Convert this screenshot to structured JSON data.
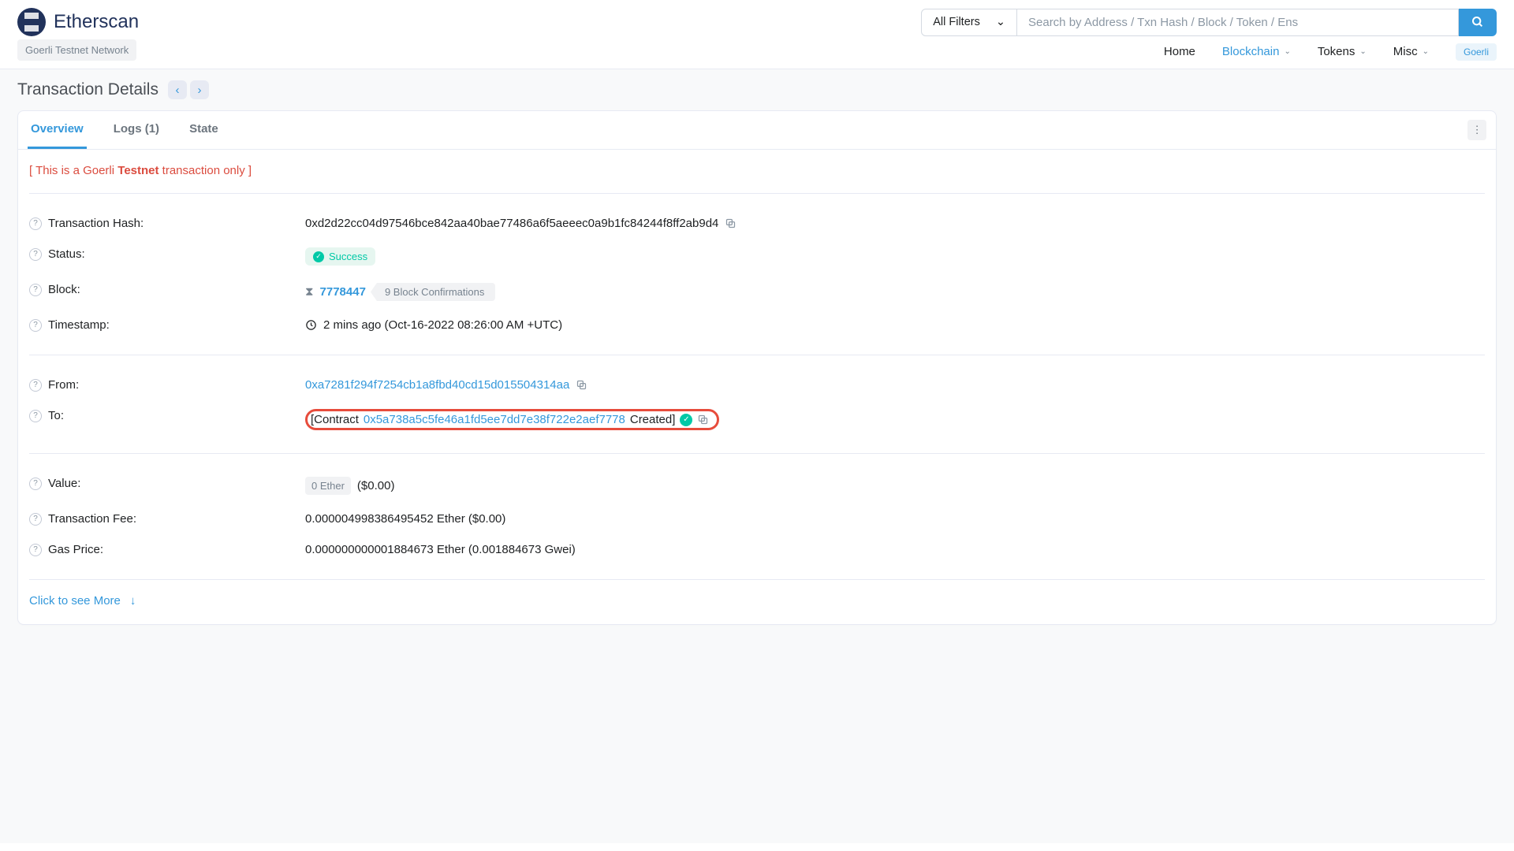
{
  "header": {
    "logo_text": "Etherscan",
    "network_badge": "Goerli Testnet Network",
    "filter_label": "All Filters",
    "search_placeholder": "Search by Address / Txn Hash / Block / Token / Ens",
    "nav": {
      "home": "Home",
      "blockchain": "Blockchain",
      "tokens": "Tokens",
      "misc": "Misc",
      "goerli_chip": "Goerli"
    }
  },
  "page": {
    "title": "Transaction Details",
    "tabs": {
      "overview": "Overview",
      "logs": "Logs (1)",
      "state": "State"
    },
    "banner_prefix": "[ This is a Goerli ",
    "banner_bold": "Testnet",
    "banner_suffix": " transaction only ]",
    "see_more": "Click to see More"
  },
  "tx": {
    "hash_label": "Transaction Hash:",
    "hash": "0xd2d22cc04d97546bce842aa40bae77486a6f5aeeec0a9b1fc84244f8ff2ab9d4",
    "status_label": "Status:",
    "status": "Success",
    "block_label": "Block:",
    "block": "7778447",
    "confirmations": "9 Block Confirmations",
    "timestamp_label": "Timestamp:",
    "timestamp": "2 mins ago (Oct-16-2022 08:26:00 AM +UTC)",
    "from_label": "From:",
    "from": "0xa7281f294f7254cb1a8fbd40cd15d015504314aa",
    "to_label": "To:",
    "to_prefix": "[Contract ",
    "to_addr": "0x5a738a5c5fe46a1fd5ee7dd7e38f722e2aef7778",
    "to_suffix": " Created]",
    "value_label": "Value:",
    "value_chip": "0 Ether",
    "value_usd": "($0.00)",
    "fee_label": "Transaction Fee:",
    "fee": "0.000004998386495452 Ether ($0.00)",
    "gas_label": "Gas Price:",
    "gas": "0.000000000001884673 Ether (0.001884673 Gwei)"
  }
}
